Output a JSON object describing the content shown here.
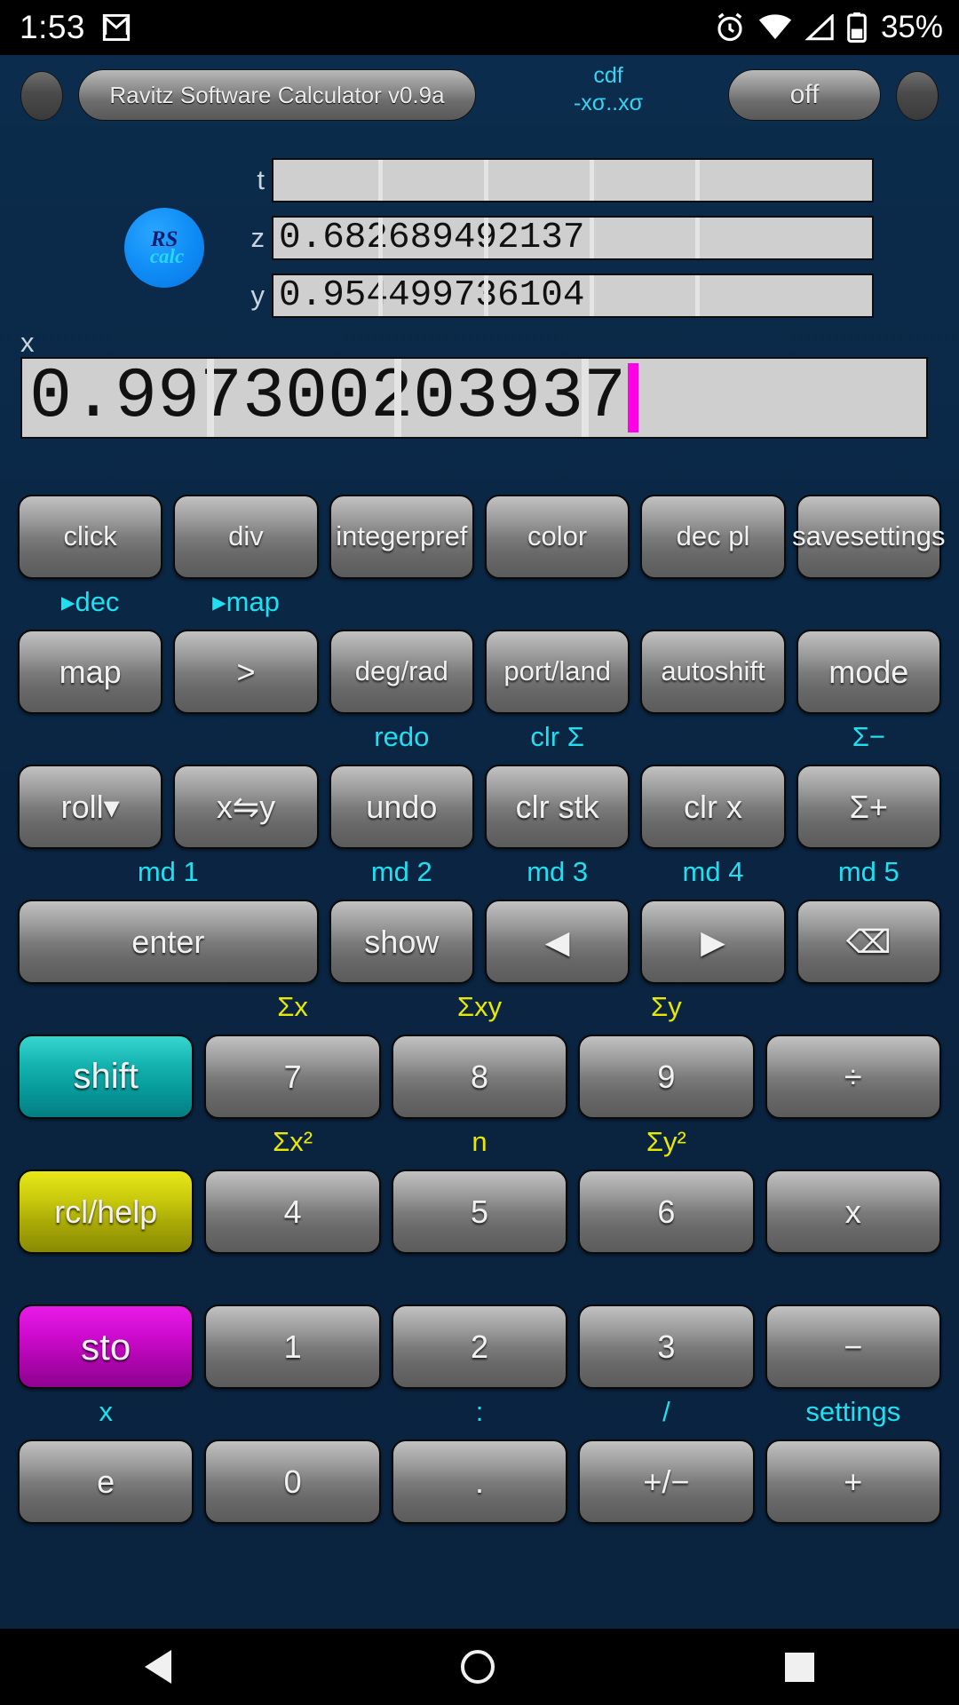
{
  "statusbar": {
    "time": "1:53",
    "icons": [
      "gmail-icon",
      "alarm-icon",
      "wifi-icon",
      "cell-signal-icon",
      "battery-icon"
    ],
    "battery_text": "35%"
  },
  "header": {
    "title": "Ravitz Software Calculator v0.9a",
    "cdf_line1": "cdf",
    "cdf_line2": "-xσ..xσ",
    "off_label": "off",
    "left_knob": "",
    "right_knob": ""
  },
  "logo": {
    "top": "RS",
    "bottom": "calc"
  },
  "display": {
    "t_label": "t",
    "t_value": "",
    "z_label": "z",
    "z_value": "0.682689492137",
    "y_label": "y",
    "y_value": "0.954499736104",
    "x_label": "x",
    "x_value": "0.997300203937",
    "cursor_color": "#ff00e6"
  },
  "colors": {
    "background": "#0a2744",
    "cyan_label": "#1fe0f0",
    "yellow_label": "#e8e800",
    "shift_key": "#14b3b0",
    "rcl_key": "#c9c90d",
    "sto_key": "#cf0bcf"
  },
  "keypad": {
    "rows": [
      {
        "labels": [],
        "keys": [
          {
            "label": "click",
            "name": "click-button",
            "style": "small"
          },
          {
            "label": "div",
            "name": "div-button",
            "style": "small"
          },
          {
            "label": "integer\npref",
            "name": "integer-pref-button",
            "style": "small"
          },
          {
            "label": "color",
            "name": "color-button",
            "style": "small"
          },
          {
            "label": "dec pl",
            "name": "dec-pl-button",
            "style": "small"
          },
          {
            "label": "save\nsettings",
            "name": "save-settings-button",
            "style": "small"
          }
        ]
      },
      {
        "labels": [
          {
            "text": "▸dec",
            "color": "cyan",
            "col": 0
          },
          {
            "text": "▸map",
            "color": "cyan",
            "col": 1
          }
        ],
        "keys": [
          {
            "label": "map",
            "name": "map-button",
            "style": ""
          },
          {
            "label": ">",
            "name": "greater-than-button",
            "style": ""
          },
          {
            "label": "deg/\nrad",
            "name": "deg-rad-button",
            "style": "small"
          },
          {
            "label": "port/\nland",
            "name": "port-land-button",
            "style": "small"
          },
          {
            "label": "auto\nshift",
            "name": "auto-shift-button",
            "style": "small"
          },
          {
            "label": "mode",
            "name": "mode-button",
            "style": ""
          }
        ]
      },
      {
        "labels": [
          {
            "text": "redo",
            "color": "cyan",
            "col": 2
          },
          {
            "text": "clr Σ",
            "color": "cyan",
            "col": 3
          },
          {
            "text": "Σ−",
            "color": "cyan",
            "col": 5
          }
        ],
        "keys": [
          {
            "label": "roll▾",
            "name": "roll-down-button",
            "style": ""
          },
          {
            "label": "x⇋y",
            "name": "x-swap-y-button",
            "style": ""
          },
          {
            "label": "undo",
            "name": "undo-button",
            "style": ""
          },
          {
            "label": "clr stk",
            "name": "clear-stack-button",
            "style": ""
          },
          {
            "label": "clr x",
            "name": "clear-x-button",
            "style": ""
          },
          {
            "label": "Σ+",
            "name": "sigma-plus-button",
            "style": ""
          }
        ]
      },
      {
        "labels": [
          {
            "text": "md 1",
            "color": "cyan",
            "col": 0
          },
          {
            "text": "md 2",
            "color": "cyan",
            "col": 2
          },
          {
            "text": "md 3",
            "color": "cyan",
            "col": 3
          },
          {
            "text": "md 4",
            "color": "cyan",
            "col": 4
          },
          {
            "text": "md 5",
            "color": "cyan",
            "col": 5
          }
        ],
        "keys": [
          {
            "label": "enter",
            "name": "enter-button",
            "style": "wide"
          },
          {
            "label": "show",
            "name": "show-button",
            "style": ""
          },
          {
            "label": "◀",
            "name": "left-arrow-button",
            "style": ""
          },
          {
            "label": "▶",
            "name": "right-arrow-button",
            "style": ""
          },
          {
            "label": "⌫",
            "name": "backspace-button",
            "style": ""
          }
        ]
      },
      {
        "labels": [
          {
            "text": "Σx",
            "color": "yellow",
            "col": 1
          },
          {
            "text": "Σxy",
            "color": "yellow",
            "col": 2
          },
          {
            "text": "Σy",
            "color": "yellow",
            "col": 3
          }
        ],
        "keys": [
          {
            "label": "shift",
            "name": "shift-button",
            "style": "teal"
          },
          {
            "label": "7",
            "name": "digit-7-button",
            "style": ""
          },
          {
            "label": "8",
            "name": "digit-8-button",
            "style": ""
          },
          {
            "label": "9",
            "name": "digit-9-button",
            "style": ""
          },
          {
            "label": "÷",
            "name": "divide-button",
            "style": ""
          }
        ]
      },
      {
        "labels": [
          {
            "text": "Σx²",
            "color": "yellow",
            "col": 1
          },
          {
            "text": "n",
            "color": "yellow",
            "col": 2
          },
          {
            "text": "Σy²",
            "color": "yellow",
            "col": 3
          }
        ],
        "keys": [
          {
            "label": "rcl/help",
            "name": "rcl-help-button",
            "style": "olive"
          },
          {
            "label": "4",
            "name": "digit-4-button",
            "style": ""
          },
          {
            "label": "5",
            "name": "digit-5-button",
            "style": ""
          },
          {
            "label": "6",
            "name": "digit-6-button",
            "style": ""
          },
          {
            "label": "x",
            "name": "multiply-button",
            "style": ""
          }
        ]
      },
      {
        "labels": [],
        "keys": [
          {
            "label": "sto",
            "name": "sto-button",
            "style": "magenta"
          },
          {
            "label": "1",
            "name": "digit-1-button",
            "style": ""
          },
          {
            "label": "2",
            "name": "digit-2-button",
            "style": ""
          },
          {
            "label": "3",
            "name": "digit-3-button",
            "style": ""
          },
          {
            "label": "−",
            "name": "subtract-button",
            "style": ""
          }
        ]
      },
      {
        "labels": [
          {
            "text": "x",
            "color": "cyan",
            "col": 0
          },
          {
            "text": ":",
            "color": "cyan",
            "col": 2
          },
          {
            "text": "/",
            "color": "cyan",
            "col": 3
          },
          {
            "text": "settings",
            "color": "cyan",
            "col": 4
          }
        ],
        "keys": [
          {
            "label": "e",
            "name": "exponent-button",
            "style": ""
          },
          {
            "label": "0",
            "name": "digit-0-button",
            "style": ""
          },
          {
            "label": ".",
            "name": "decimal-point-button",
            "style": ""
          },
          {
            "label": "+/−",
            "name": "sign-toggle-button",
            "style": ""
          },
          {
            "label": "+",
            "name": "add-button",
            "style": ""
          }
        ]
      }
    ]
  },
  "navbar": {
    "back": "back-icon",
    "home": "home-icon",
    "recent": "recent-apps-icon"
  }
}
